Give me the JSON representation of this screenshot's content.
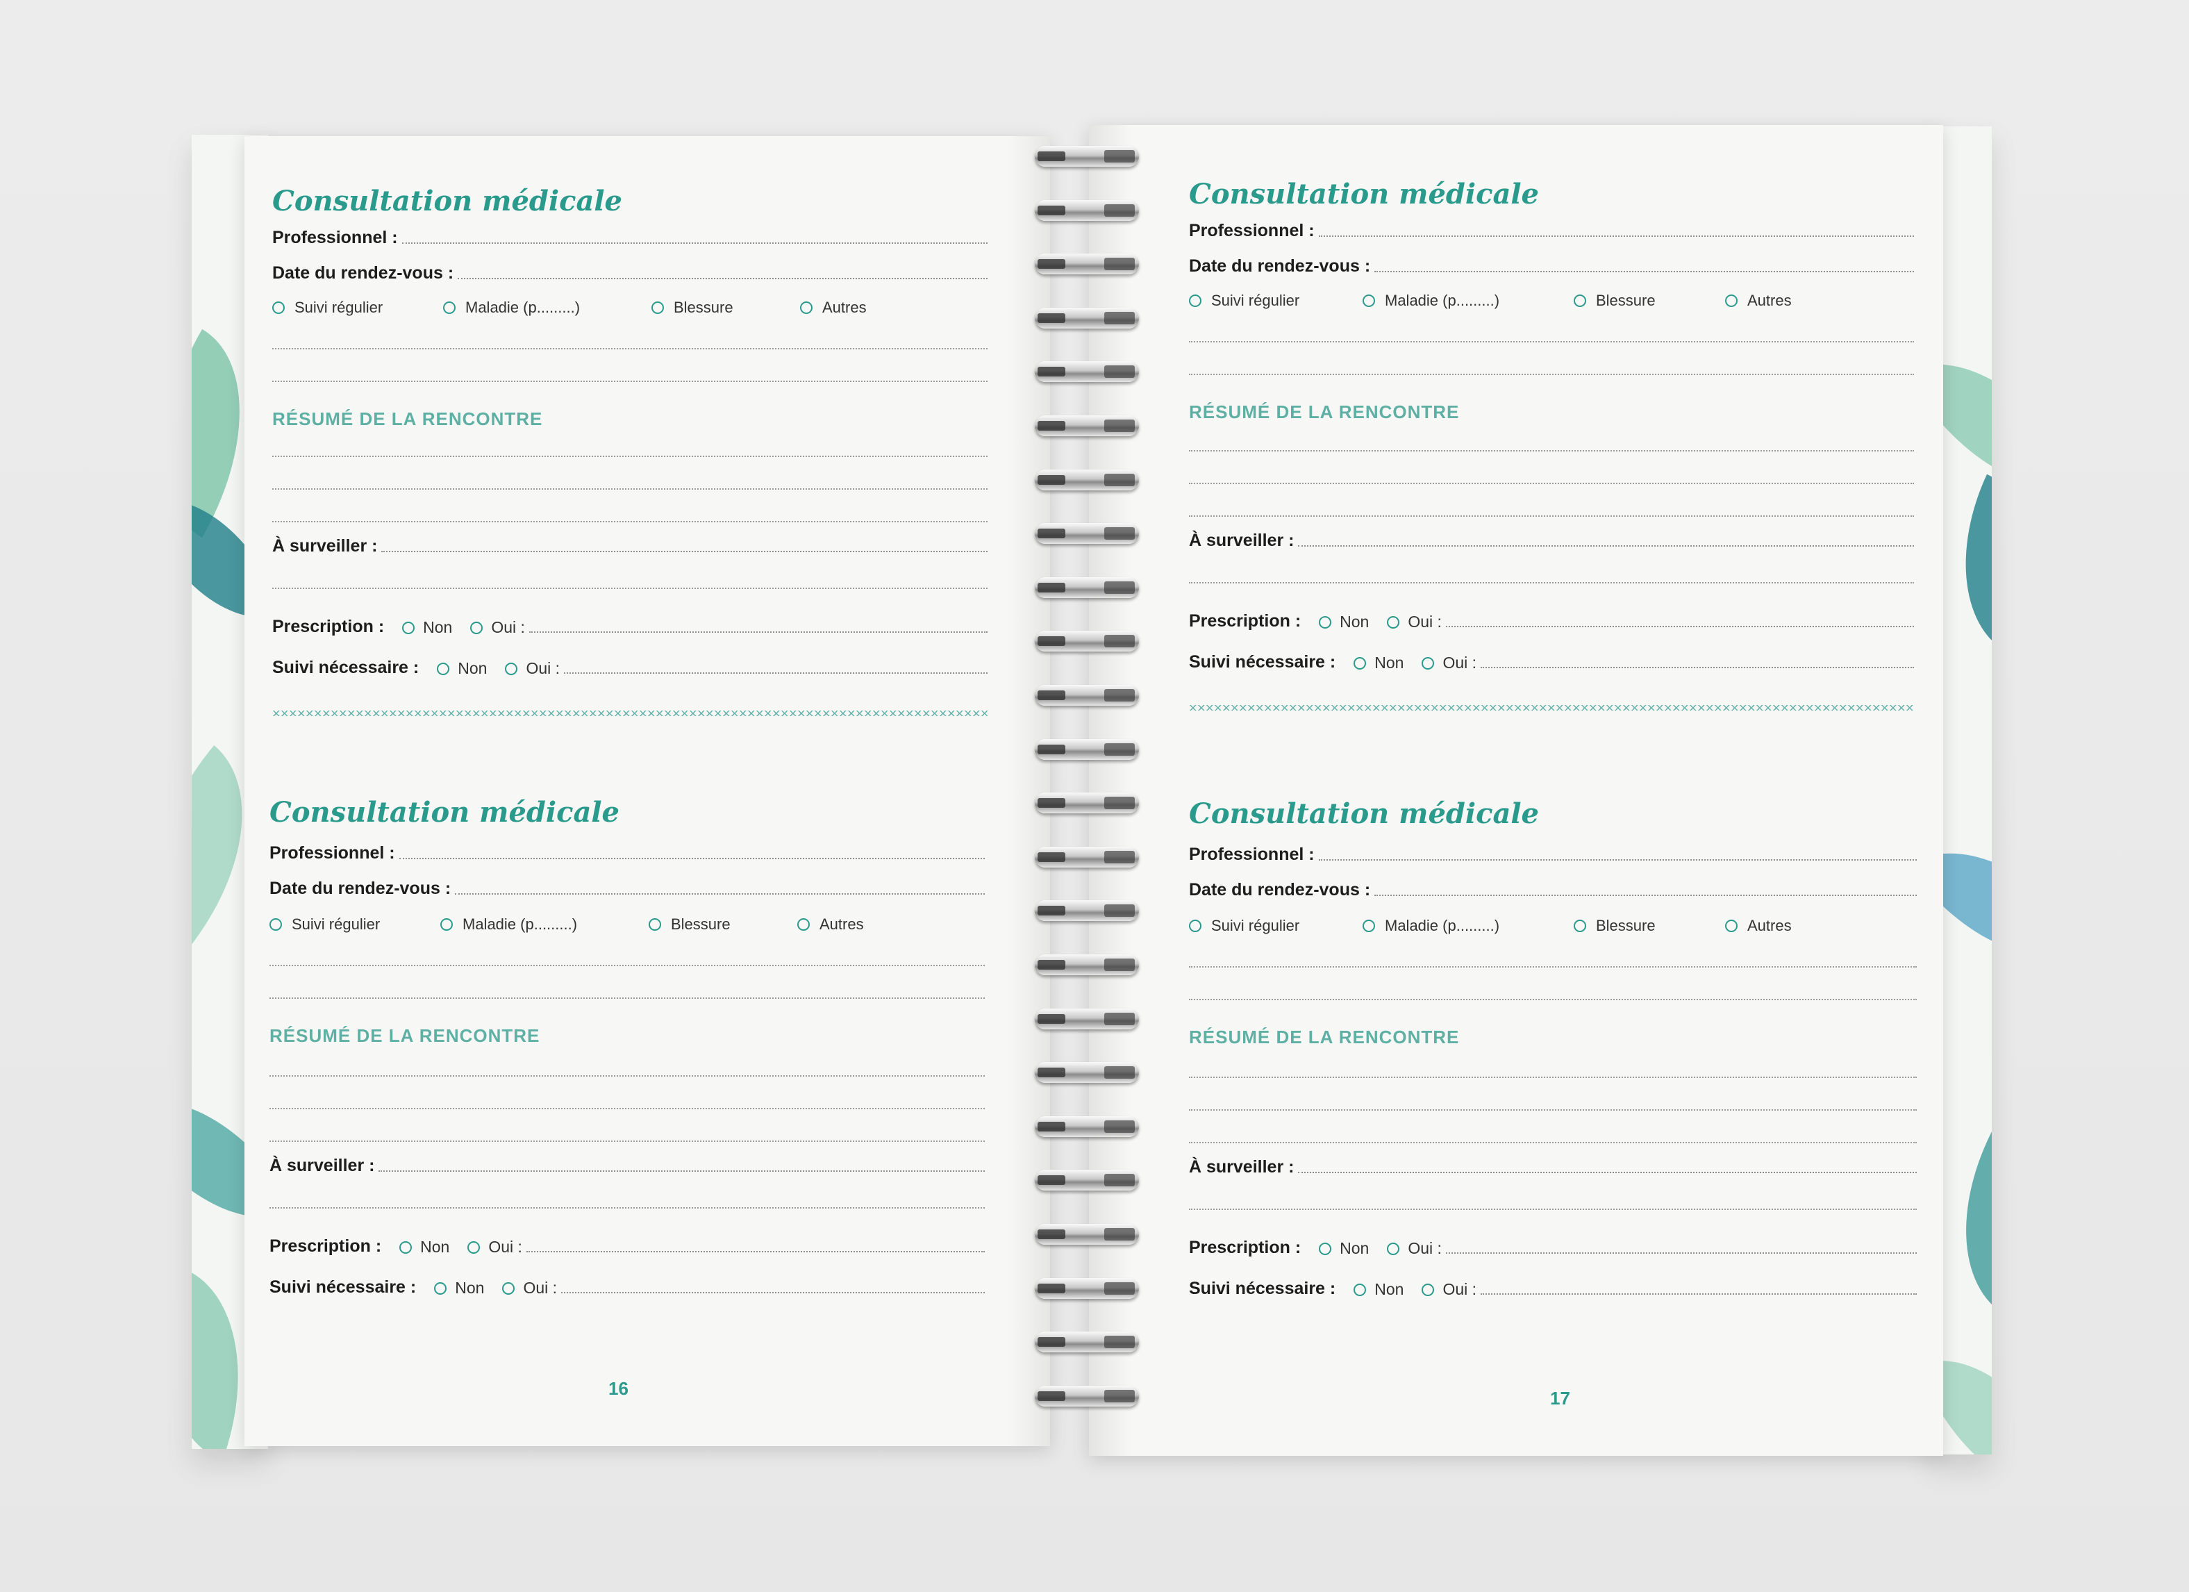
{
  "form": {
    "title": "Consultation médicale",
    "professional_label": "Professionnel :",
    "date_label": "Date du rendez-vous :",
    "reason_options": [
      "Suivi régulier",
      "Maladie (p.........)",
      "Blessure",
      "Autres"
    ],
    "summary_heading": "RÉSUMÉ DE LA RENCONTRE",
    "watch_label": "À surveiller :",
    "prescription_label": "Prescription :",
    "followup_label": "Suivi nécessaire :",
    "no_label": "Non",
    "yes_label": "Oui :"
  },
  "pages": {
    "left_number": "16",
    "right_number": "17"
  },
  "colors": {
    "accent": "#2a9a8c",
    "heading": "#5fb0a4",
    "paper": "#f7f7f5",
    "background": "#ececec"
  }
}
